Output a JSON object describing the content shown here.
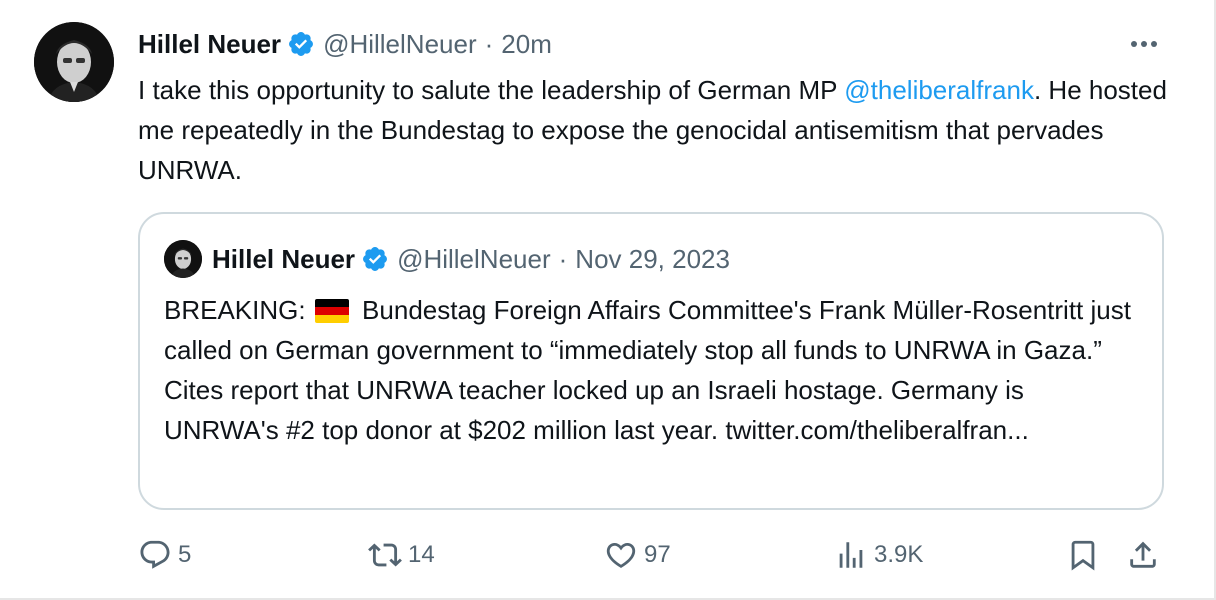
{
  "tweet": {
    "author_name": "Hillel Neuer",
    "handle": "@HillelNeuer",
    "separator": "·",
    "time": "20m",
    "text_before": "I take this opportunity to salute the leadership of German MP ",
    "mention": "@theliberalfrank",
    "text_after": ". He hosted me repeatedly in the Bundestag to expose the genocidal antisemitism that pervades UNRWA."
  },
  "quote": {
    "author_name": "Hillel Neuer",
    "handle": "@HillelNeuer",
    "separator": "·",
    "date": "Nov 29, 2023",
    "text_prefix": "BREAKING: ",
    "flag_icon": "germany-flag",
    "text_body": " Bundestag Foreign Affairs Committee's Frank Müller-Rosentritt just called on German government to “immediately stop all funds to UNRWA in Gaza.” Cites report that UNRWA teacher locked up an Israeli hostage. Germany is UNRWA's #2 top donor at $202 million last year. twitter.com/theliberalfran..."
  },
  "actions": {
    "replies": "5",
    "reposts": "14",
    "likes": "97",
    "views": "3.9K"
  },
  "icons": {
    "verified": "verified-badge-icon",
    "more": "more-options-icon",
    "reply": "reply-icon",
    "repost": "repost-icon",
    "like": "heart-icon",
    "views": "views-icon",
    "bookmark": "bookmark-icon",
    "share": "share-icon"
  },
  "colors": {
    "accent": "#1d9bf0",
    "text": "#0f1419",
    "secondary": "#536471",
    "border": "#cfd9de"
  }
}
